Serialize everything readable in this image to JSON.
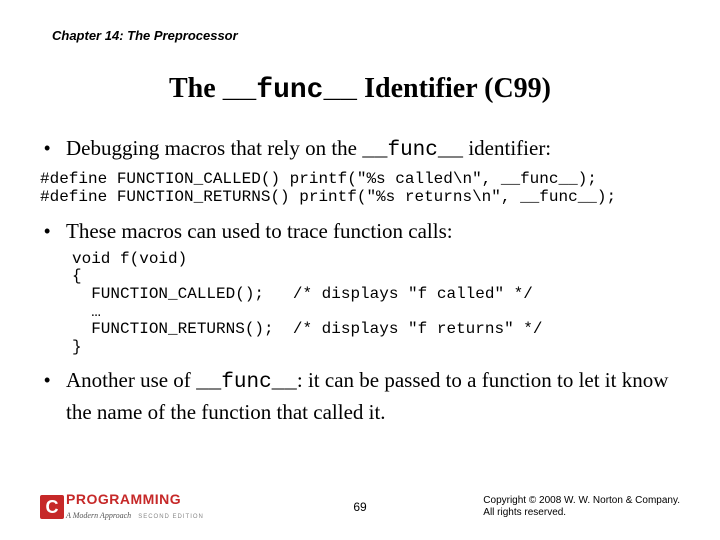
{
  "chapter": "Chapter 14: The Preprocessor",
  "title": {
    "prefix": "The ",
    "mono": "__func__",
    "suffix": " Identifier (C99)"
  },
  "bullets": {
    "b1": {
      "pre": "Debugging macros that rely on the ",
      "mono": "__func__",
      "post": " identifier:"
    },
    "code1": "#define FUNCTION_CALLED() printf(\"%s called\\n\", __func__);\n#define FUNCTION_RETURNS() printf(\"%s returns\\n\", __func__);",
    "b2": "These macros can used to trace function calls:",
    "code2": "void f(void)\n{\n  FUNCTION_CALLED();   /* displays \"f called\" */\n  …\n  FUNCTION_RETURNS();  /* displays \"f returns\" */\n}",
    "b3": {
      "pre": "Another use of ",
      "mono": "__func__",
      "post": ": it can be passed to a function to let it know the name of the function that called it."
    }
  },
  "footer": {
    "logo_letter": "C",
    "logo_main": "PROGRAMMING",
    "logo_sub": "A Modern Approach",
    "logo_ed": "SECOND EDITION",
    "page": "69",
    "copyright_l1": "Copyright © 2008 W. W. Norton & Company.",
    "copyright_l2": "All rights reserved."
  }
}
